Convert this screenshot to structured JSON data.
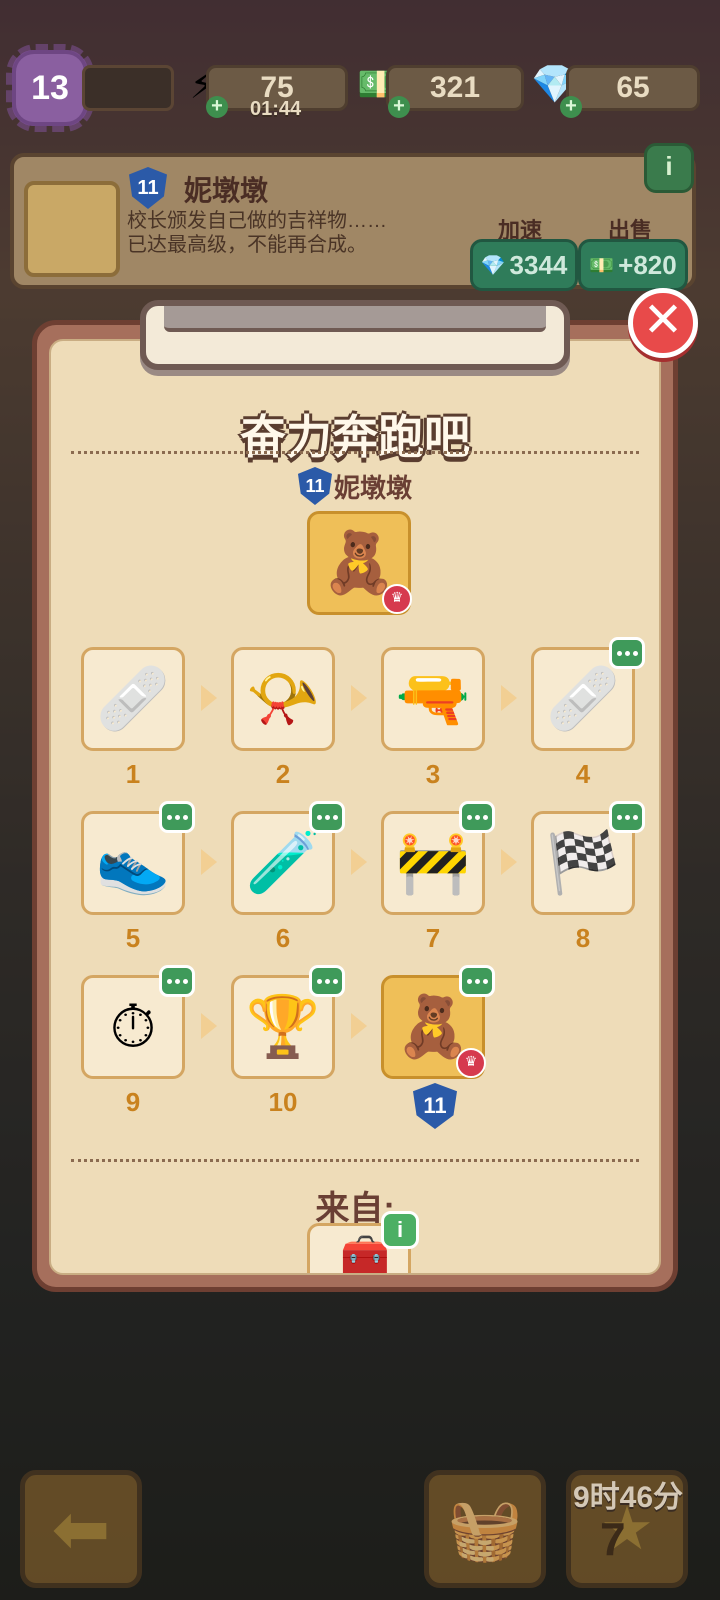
{
  "hud": {
    "level": "13",
    "energy": "75",
    "energy_timer": "01:44",
    "cash": "321",
    "gems": "65"
  },
  "item_info": {
    "level": "11",
    "name": "妮墩墩",
    "description_line1": "校长颁发自己做的吉祥物……",
    "description_line2": "已达最高级，不能再合成。",
    "speed_label": "加速",
    "sell_label": "出售",
    "speed_cost": "3344",
    "sell_price": "+820",
    "info_icon": "i"
  },
  "panel": {
    "title": "奋力奔跑吧",
    "subtitle_level": "11",
    "subtitle_name": "妮墩墩",
    "from_label": "来自:",
    "from_info_icon": "i",
    "close_icon": "✕"
  },
  "chain": [
    {
      "num": "1",
      "icon": "🩹"
    },
    {
      "num": "2",
      "icon": "📯"
    },
    {
      "num": "3",
      "icon": "🔫"
    },
    {
      "num": "4",
      "icon": "🩹"
    },
    {
      "num": "5",
      "icon": "👟"
    },
    {
      "num": "6",
      "icon": "🧪"
    },
    {
      "num": "7",
      "icon": "🚧"
    },
    {
      "num": "8",
      "icon": "🏁"
    },
    {
      "num": "9",
      "icon": "⏱"
    },
    {
      "num": "10",
      "icon": "🏆"
    },
    {
      "num": "11",
      "icon": "🧸"
    }
  ],
  "bottom": {
    "timer": "9时46分",
    "count": "7"
  }
}
